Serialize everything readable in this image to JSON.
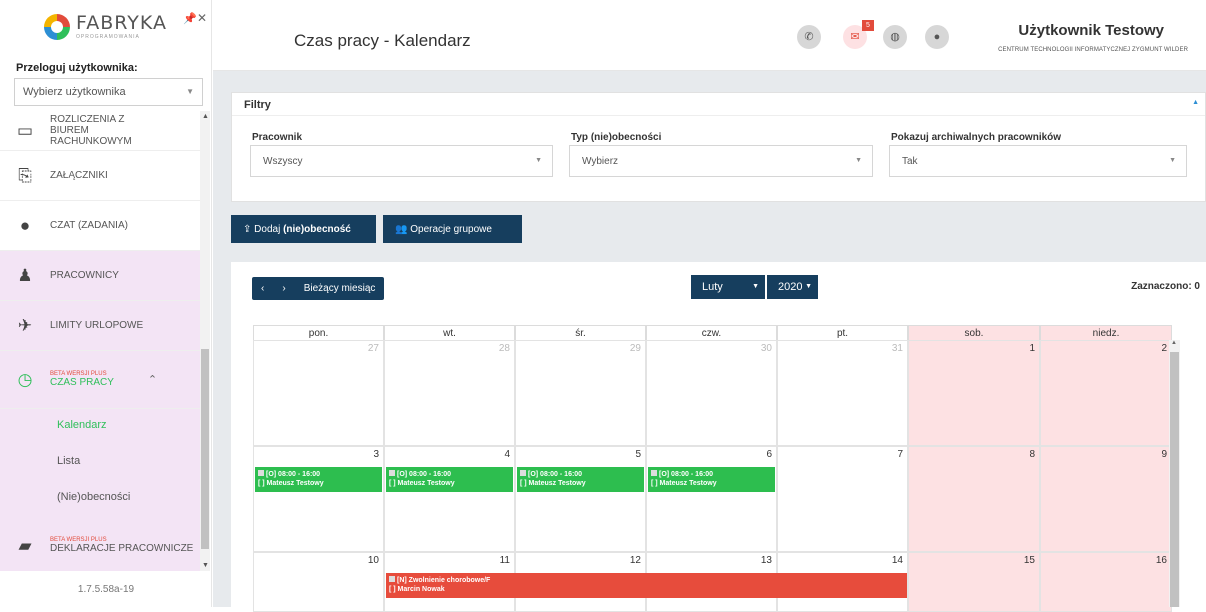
{
  "sidebar": {
    "logo_text": "FABRYKA",
    "logo_sub": "OPROGRAMOWANIA",
    "browse_label": "Przeloguj użytkownika:",
    "browse_placeholder": "Wybierz użytkownika",
    "items": [
      {
        "label": "ROZLICZENIA Z BIUREM RACHUNKOWYM",
        "icon": "credit-card-icon",
        "glyph": "▭"
      },
      {
        "label": "ZAŁĄCZNIKI",
        "icon": "paperclip-icon",
        "glyph": "⎘"
      },
      {
        "label": "CZAT (ZADANIA)",
        "icon": "chat-icon",
        "glyph": "💬"
      },
      {
        "label": "PRACOWNICY",
        "icon": "person-icon",
        "glyph": "♟"
      },
      {
        "label": "LIMITY URLOPOWE",
        "icon": "plane-icon",
        "glyph": "✈"
      },
      {
        "label": "CZAS PRACY",
        "beta": "BETA WERSJI PLUS",
        "icon": "clock-icon",
        "glyph": "◷"
      },
      {
        "label": "DEKLARACJE PRACOWNICZE",
        "beta": "BETA WERSJI PLUS",
        "icon": "book-icon",
        "glyph": "▰"
      }
    ],
    "sub_items": [
      "Kalendarz",
      "Lista",
      "(Nie)obecności"
    ],
    "version": "1.7.5.58a-19"
  },
  "header": {
    "title": "Czas pracy - Kalendarz",
    "mail_count": "5",
    "user_name": "Użytkownik Testowy",
    "user_org": "CENTRUM TECHNOLOGII INFORMATYCZNEJ ZYGMUNT WILDER"
  },
  "filters": {
    "title": "Filtry",
    "employee_label": "Pracownik",
    "employee_value": "Wszyscy",
    "type_label": "Typ (nie)obecności",
    "type_value": "Wybierz",
    "archive_label": "Pokazuj archiwalnych pracowników",
    "archive_value": "Tak"
  },
  "actions": {
    "add_prefix": "Dodaj ",
    "add_bold": "(nie)obecność",
    "group_ops": "Operacje grupowe"
  },
  "calendar": {
    "prev": "‹",
    "next": "›",
    "current_month": "Bieżący miesiąc",
    "month": "Luty",
    "year": "2020",
    "selected": "Zaznaczono: 0",
    "days": [
      "pon.",
      "wt.",
      "śr.",
      "czw.",
      "pt.",
      "sob.",
      "niedz."
    ],
    "week1": [
      "27",
      "28",
      "29",
      "30",
      "31",
      "1",
      "2"
    ],
    "week2": [
      "3",
      "4",
      "5",
      "6",
      "7",
      "8",
      "9"
    ],
    "week3": [
      "10",
      "11",
      "12",
      "13",
      "14",
      "15",
      "16"
    ],
    "event_time": "[O] 08:00 - 16:00",
    "event_person": "[ ] Mateusz Testowy",
    "sick_title": "[N] Zwolnienie chorobowe/F",
    "sick_person": "[ ] Marcin Nowak"
  },
  "colors": {
    "accent": "#163e5e",
    "green": "#2dbe4f",
    "red": "#e74c3c",
    "weekend": "#fde1e3",
    "menu_pink": "#f3e4f5"
  }
}
